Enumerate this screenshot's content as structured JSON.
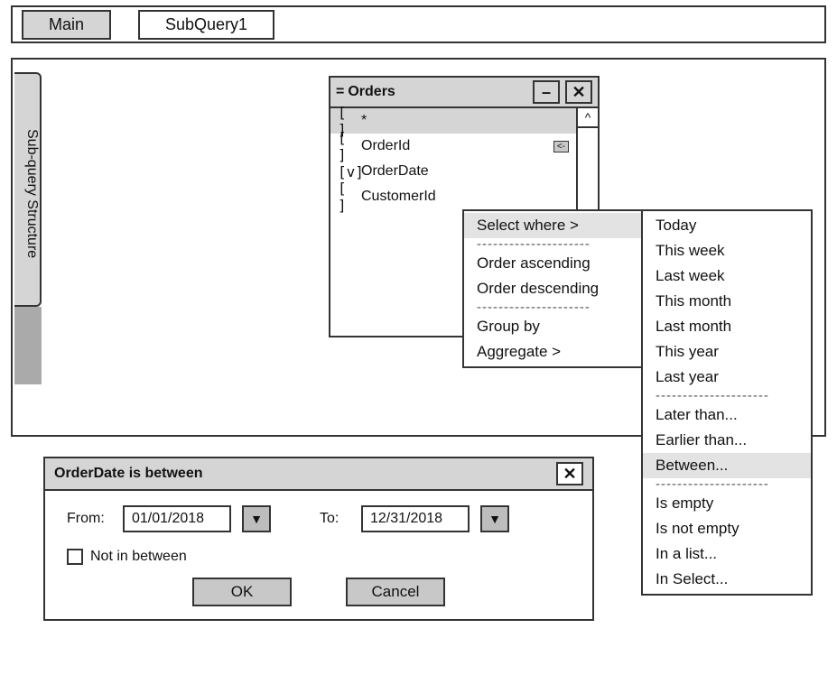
{
  "tabs": {
    "main": "Main",
    "sub": "SubQuery1"
  },
  "side_label": "Sub-query Structure",
  "table": {
    "title_prefix": "=",
    "title": "Orders",
    "rows": [
      {
        "cb": "[ ]",
        "label": "*",
        "selected": true,
        "key": false
      },
      {
        "cb": "[ ]",
        "label": "OrderId",
        "selected": false,
        "key": true
      },
      {
        "cb": "[v]",
        "label": "OrderDate",
        "selected": false,
        "key": false
      },
      {
        "cb": "[ ]",
        "label": "CustomerId",
        "selected": false,
        "key": false
      }
    ],
    "key_marker": "<-"
  },
  "menu1": {
    "select_where": "Select where >",
    "order_asc": "Order ascending",
    "order_desc": "Order descending",
    "group_by": "Group by",
    "aggregate": "Aggregate >",
    "sep": "---------------------"
  },
  "menu2": {
    "today": "Today",
    "this_week": "This week",
    "last_week": "Last week",
    "this_month": "This month",
    "last_month": "Last month",
    "this_year": "This year",
    "last_year": "Last year",
    "later_than": "Later than...",
    "earlier_than": "Earlier than...",
    "between": "Between...",
    "is_empty": "Is empty",
    "is_not_empty": "Is not empty",
    "in_list": "In a list...",
    "in_select": "In Select...",
    "sep": "---------------------"
  },
  "dialog": {
    "title": "OrderDate is between",
    "from_label": "From:",
    "to_label": "To:",
    "from_value": "01/01/2018",
    "to_value": "12/31/2018",
    "not_label": "Not in between",
    "ok": "OK",
    "cancel": "Cancel"
  },
  "icons": {
    "close": "✕",
    "minimize": "–",
    "scroll_up": "^",
    "dropdown": "▼"
  }
}
